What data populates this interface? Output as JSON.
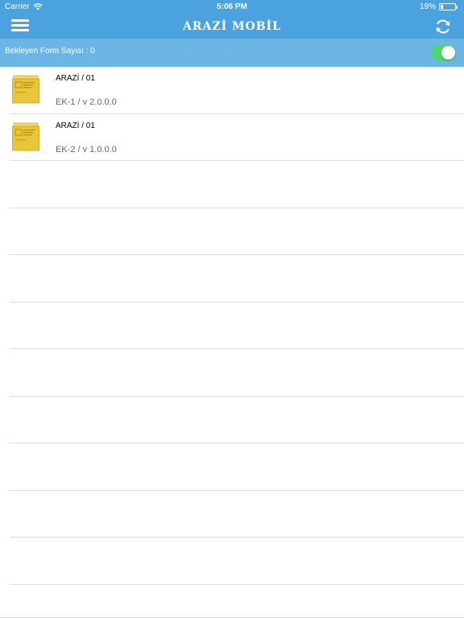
{
  "status_bar": {
    "carrier": "Carrier",
    "time": "5:06 PM",
    "battery": "19%",
    "battery_level": 0.19
  },
  "nav": {
    "title": "ARAZİ MOBİL",
    "menu_icon": "hamburger-menu-icon",
    "refresh_icon": "refresh-icon"
  },
  "pending": {
    "label": "Bekleyen Form Sayısı : 0",
    "toggle_on": true
  },
  "forms": [
    {
      "title": "ARAZİ / 01",
      "version": "EK-1 / v 2.0.0.0"
    },
    {
      "title": "ARAZİ / 01",
      "version": "EK-2 / v 1.0.0.0"
    }
  ],
  "colors": {
    "header": "#4aa3df",
    "pending_bar": "#6cb6e6",
    "toggle": "#4cd964",
    "form_icon": "#e8c53a"
  }
}
